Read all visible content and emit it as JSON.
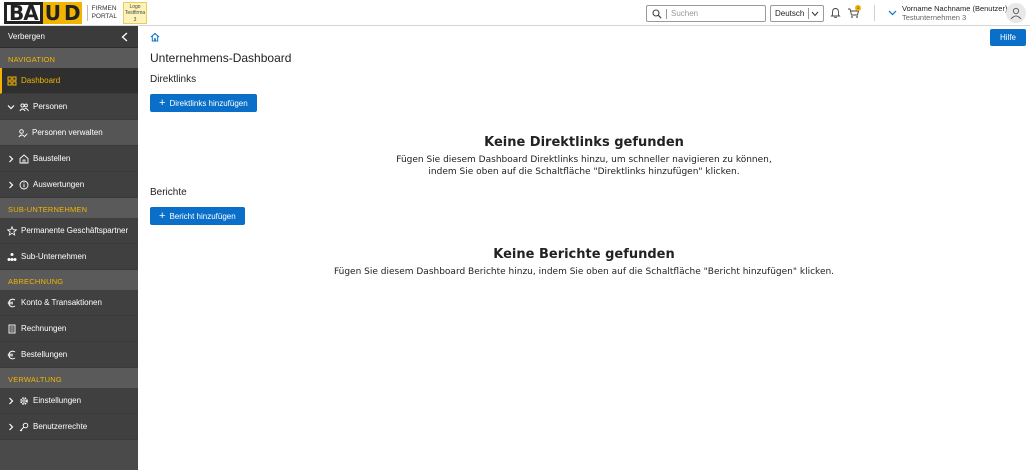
{
  "header": {
    "logo": {
      "text_part1": "BA",
      "text_part2": "U",
      "text_part3": "D",
      "sub_line1": "FIRMEN",
      "sub_line2": "PORTAL",
      "badge_line1": "Logo",
      "badge_line2": "Testfirma",
      "badge_line3": "3"
    },
    "search": {
      "placeholder": "Suchen"
    },
    "language": {
      "selected": "Deutsch"
    },
    "cart_count": "1",
    "user": {
      "name": "Vorname Nachname (Benutzer)",
      "company": "Testunternehmen 3"
    }
  },
  "sidebar": {
    "hide_label": "Verbergen",
    "sections": {
      "navigation": "NAVIGATION",
      "sub_companies": "SUB-UNTERNEHMEN",
      "billing": "ABRECHNUNG",
      "administration": "VERWALTUNG"
    },
    "items": {
      "dashboard": "Dashboard",
      "persons": "Personen",
      "manage_persons": "Personen verwalten",
      "sites": "Baustellen",
      "reports": "Auswertungen",
      "partners": "Permanente Geschäftspartner",
      "subcompanies": "Sub-Unternehmen",
      "account": "Konto & Transaktionen",
      "invoices": "Rechnungen",
      "orders": "Bestellungen",
      "settings": "Einstellungen",
      "rights": "Benutzerrechte"
    }
  },
  "main": {
    "help_label": "Hilfe",
    "title": "Unternehmens-Dashboard",
    "direct_links": {
      "heading": "Direktlinks",
      "button": "Direktlinks hinzufügen",
      "empty_title": "Keine Direktlinks gefunden",
      "empty_line1": "Fügen Sie diesem Dashboard Direktlinks hinzu, um schneller navigieren zu können,",
      "empty_line2": "indem Sie oben auf die Schaltfläche \"Direktlinks hinzufügen\" klicken."
    },
    "reports": {
      "heading": "Berichte",
      "button": "Bericht hinzufügen",
      "empty_title": "Keine Berichte gefunden",
      "empty_line1": "Fügen Sie diesem Dashboard Berichte hinzu, indem Sie oben auf die Schaltfläche \"Bericht hinzufügen\" klicken."
    }
  },
  "colors": {
    "accent": "#f2b400",
    "primary": "#0a6fc9",
    "sidebar": "#4a4a4a"
  }
}
